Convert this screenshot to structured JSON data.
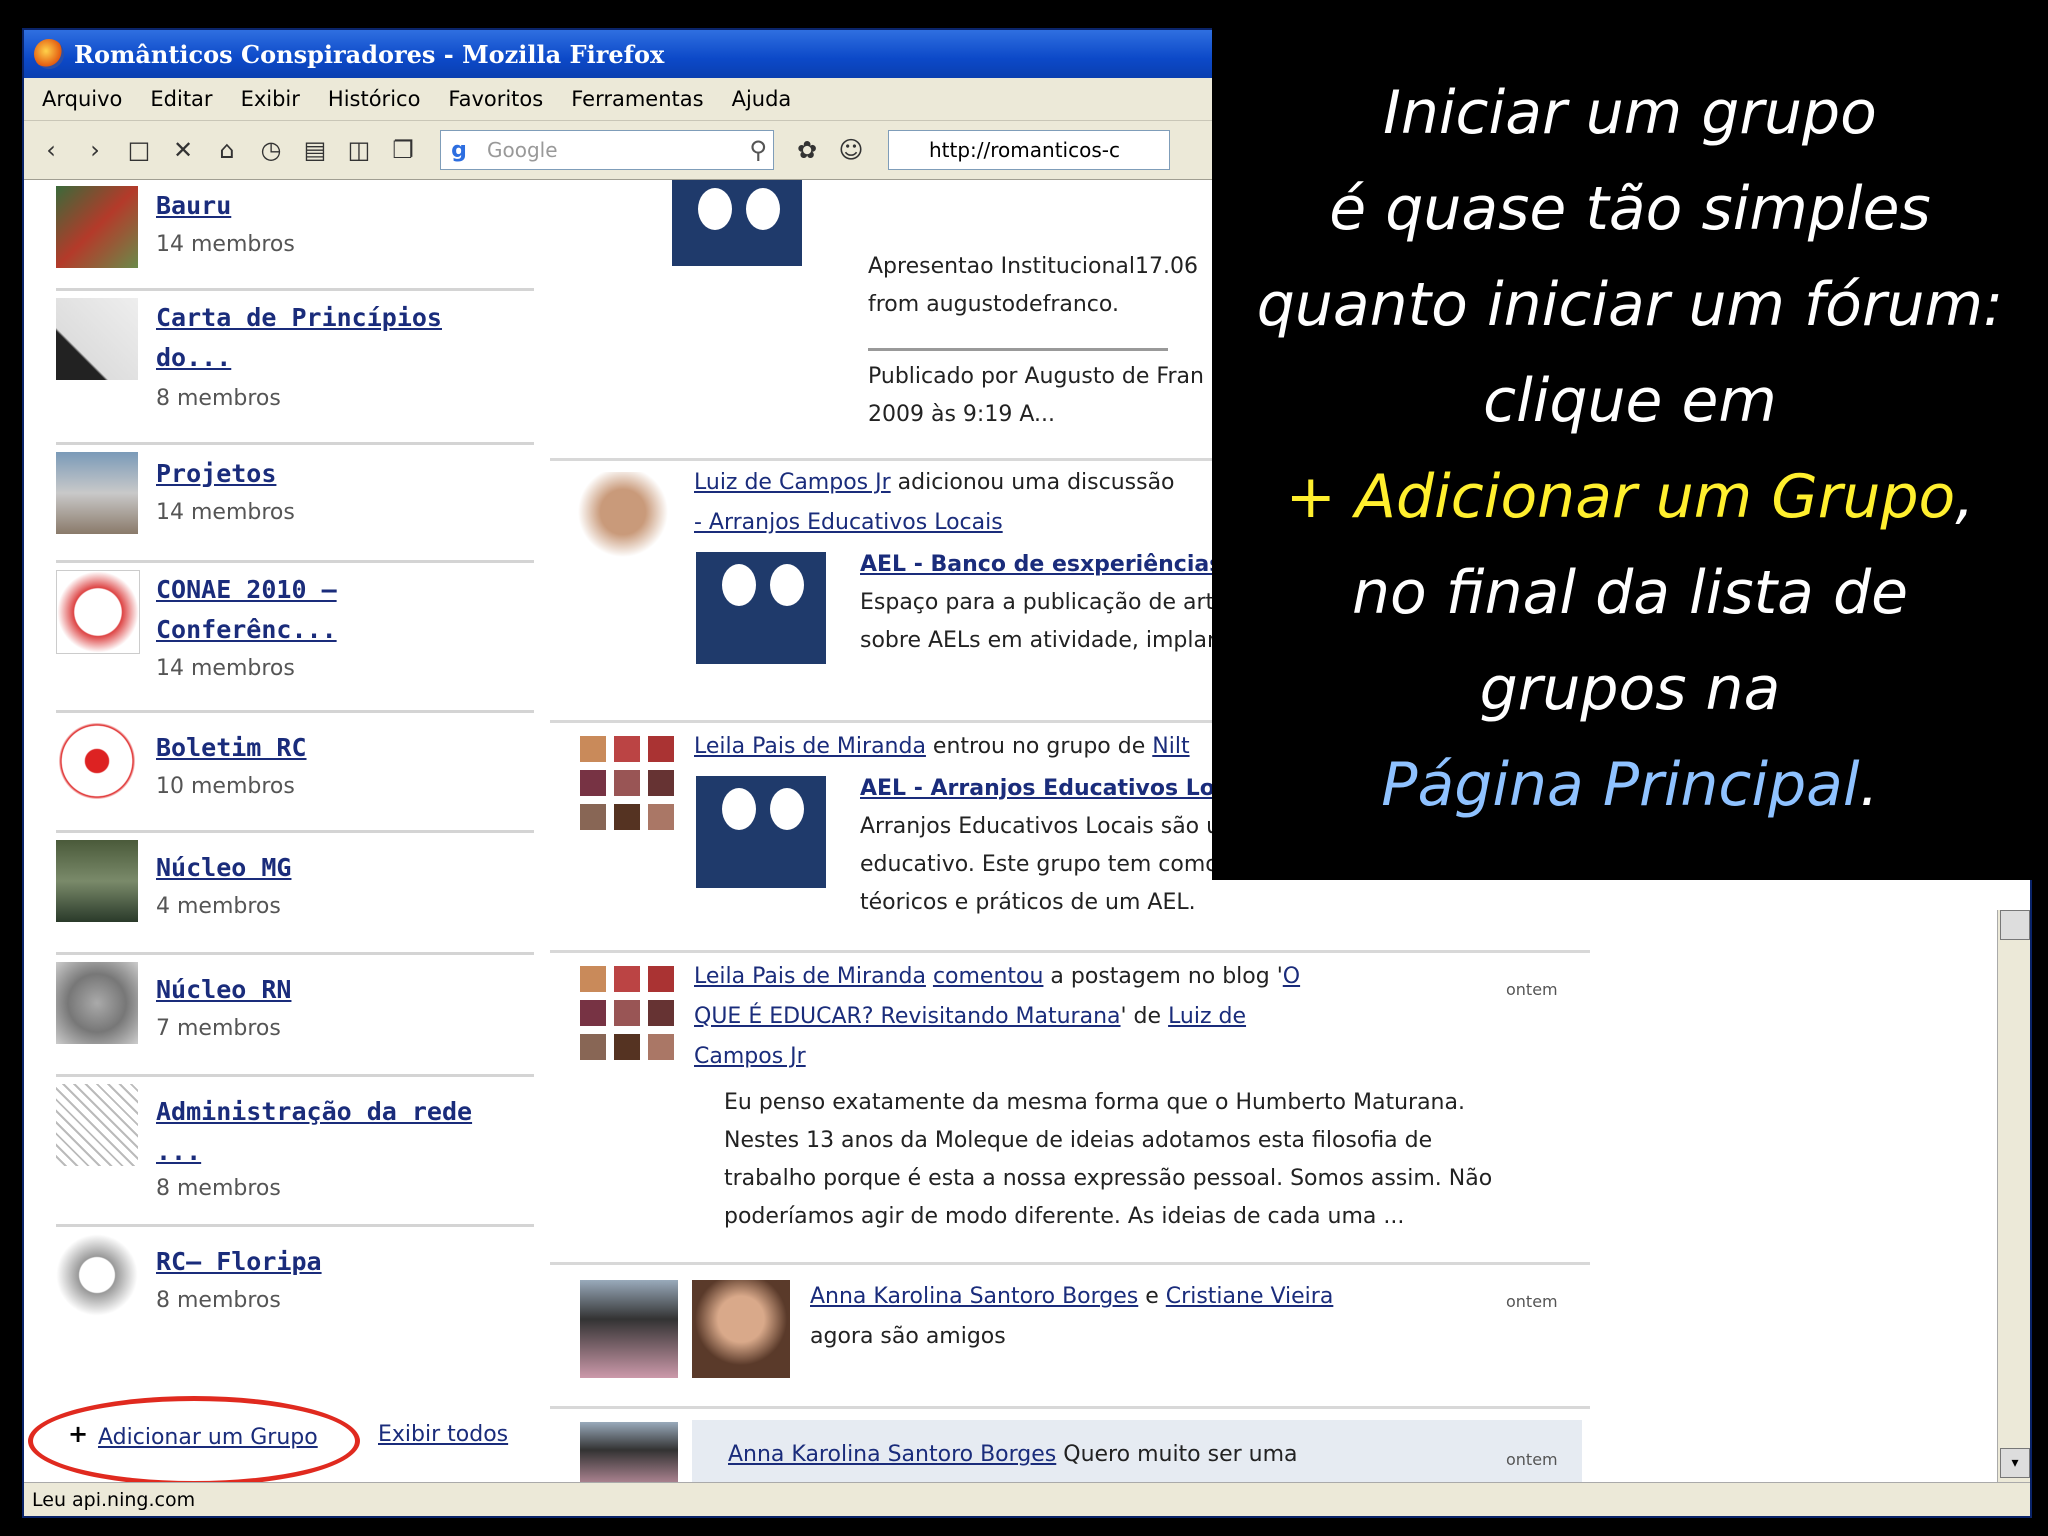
{
  "window": {
    "title": "Românticos Conspiradores - Mozilla Firefox",
    "menu": [
      "Arquivo",
      "Editar",
      "Exibir",
      "Histórico",
      "Favoritos",
      "Ferramentas",
      "Ajuda"
    ],
    "search_placeholder": "Google",
    "url": "http://romanticos-c"
  },
  "sidebar": {
    "groups": [
      {
        "name": "Bauru",
        "name2": "",
        "count": "14 membros"
      },
      {
        "name": "Carta de Princípios",
        "name2": "do...",
        "count": "8 membros"
      },
      {
        "name": "Projetos",
        "name2": "",
        "count": "14 membros"
      },
      {
        "name": "CONAE 2010 –",
        "name2": "Conferênc...",
        "count": "14 membros"
      },
      {
        "name": "Boletim RC",
        "name2": "",
        "count": "10 membros"
      },
      {
        "name": "Núcleo MG",
        "name2": "",
        "count": "4 membros"
      },
      {
        "name": "Núcleo RN",
        "name2": "",
        "count": "7 membros"
      },
      {
        "name": "Administração da rede",
        "name2": "...",
        "count": "8 membros"
      },
      {
        "name": "RC– Floripa",
        "name2": "",
        "count": "8 membros"
      }
    ],
    "add_group": "Adicionar um Grupo",
    "add_plus": "+",
    "view_all": "Exibir todos"
  },
  "feed": {
    "item0": {
      "l1": "Apresentao Institucional17.06",
      "l2": "from augustodefranco.",
      "l3": "Publicado por Augusto de Fran",
      "l4": "2009 às 9:19 A..."
    },
    "item1": {
      "actor": "Luiz de Campos Jr",
      "action": " adicionou uma discussão",
      "group": "- Arranjos Educativos Locais",
      "title": "AEL - Banco de esxperiências",
      "d1": "Espaço para a publicação de arti",
      "d2": "sobre AELs em atividade, implan"
    },
    "item2": {
      "actor": "Leila Pais de Miranda",
      "action": " entrou no grupo de ",
      "who": "Nilt",
      "title": "AEL - Arranjos Educativos Locais",
      "d1": "Arranjos Educativos Locais são u",
      "d2": "educativo. Este grupo tem como",
      "d3": "téoricos e práticos de um AEL."
    },
    "item3": {
      "actor": "Leila Pais de Miranda",
      "verb": "comentou",
      "mid": " a postagem no blog '",
      "post1": "O",
      "post2": "QUE É EDUCAR? Revisitando Maturana",
      "de": "' de ",
      "author1": "Luiz de",
      "author2": "Campos Jr",
      "q1": "Eu penso exatamente da mesma forma que o Humberto Maturana.",
      "q2": "Nestes 13 anos da Moleque de ideias adotamos esta filosofia de",
      "q3": "trabalho porque é esta a nossa expressão pessoal. Somos assim. Não",
      "q4": "poderíamos agir de modo diferente. As ideias de cada uma ...",
      "time": "ontem"
    },
    "item4": {
      "a1": "Anna Karolina Santoro Borges",
      "and": " e ",
      "a2": "Cristiane Vieira",
      "line2": "agora são amigos",
      "time": "ontem"
    },
    "item5": {
      "a1": "Anna Karolina Santoro Borges",
      "rest": " Quero muito ser uma",
      "time": "ontem"
    }
  },
  "status": "Leu api.ning.com",
  "overlay": {
    "l1": "Iniciar um grupo",
    "l2": "é quase tão simples",
    "l3": "quanto iniciar um fórum:",
    "l4": "clique em",
    "l5": "+ Adicionar um Grupo",
    "l5b": ",",
    "l6": "no final da lista de",
    "l7": "grupos na",
    "l8": "Página Principal",
    "l8b": "."
  }
}
